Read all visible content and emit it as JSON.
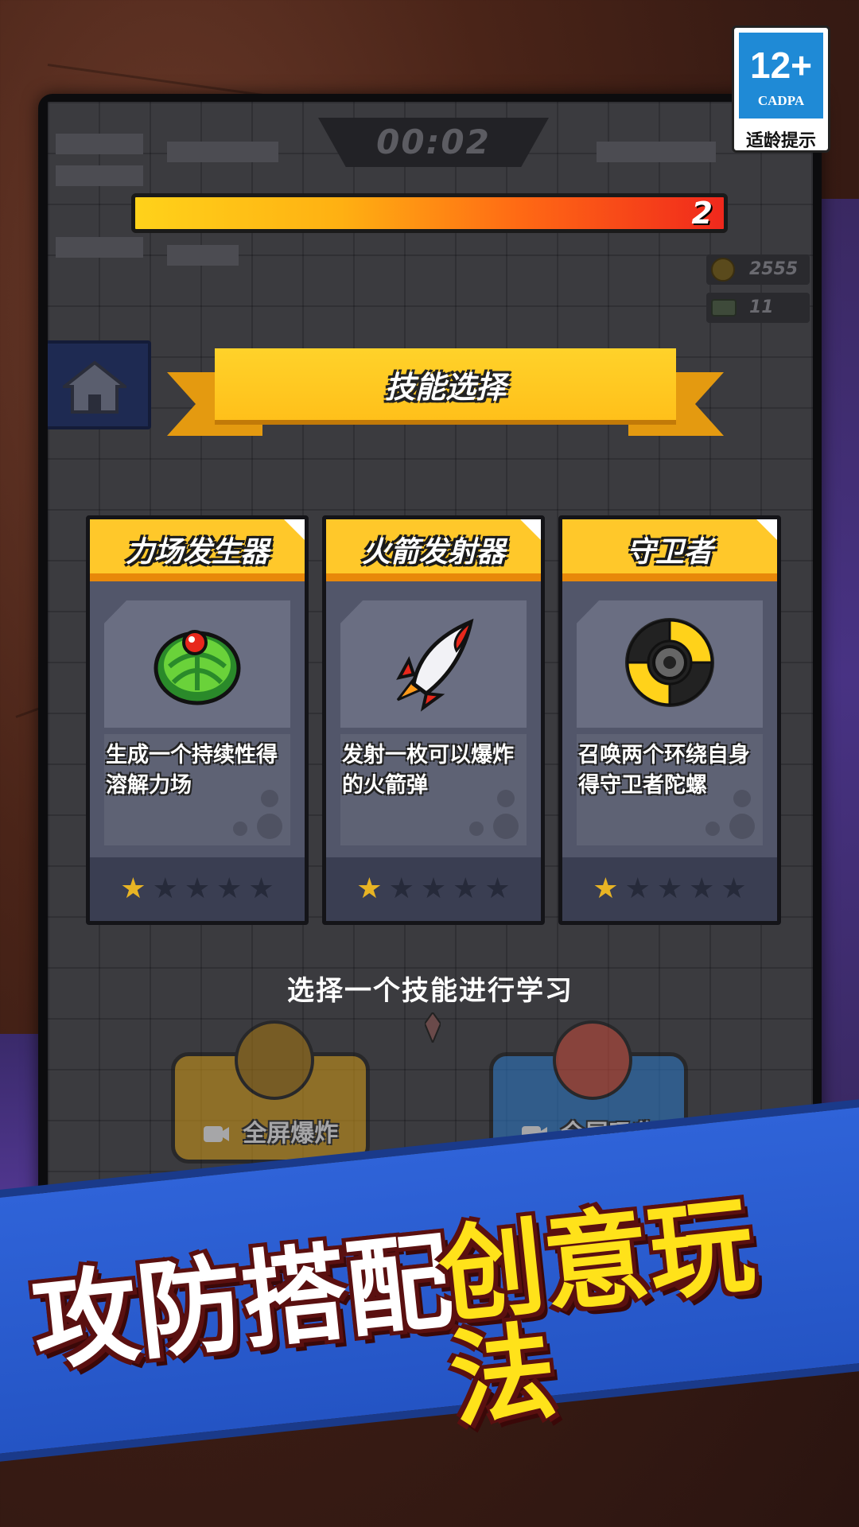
{
  "age_rating": {
    "number": "12+",
    "org": "CADPA",
    "tip": "适龄提示"
  },
  "hud": {
    "timer": "00:02",
    "level": "2",
    "coins": "2555",
    "chips": "11"
  },
  "panel": {
    "title": "技能选择"
  },
  "skills": [
    {
      "name": "力场发生器",
      "description": "生成一个持续性得溶解力场",
      "icon": "force-field-generator-icon",
      "stars_filled": 1,
      "stars_total": 5
    },
    {
      "name": "火箭发射器",
      "description": "发射一枚可以爆炸的火箭弹",
      "icon": "rocket-launcher-icon",
      "stars_filled": 1,
      "stars_total": 5
    },
    {
      "name": "守卫者",
      "description": "召唤两个环绕自身得守卫者陀螺",
      "icon": "guardian-shuriken-icon",
      "stars_filled": 1,
      "stars_total": 5
    }
  ],
  "prompt": "选择一个技能进行学习",
  "actions": {
    "full_screen_explode": "全屏爆炸",
    "full_screen_absorb": "全屏吸收"
  },
  "banner": {
    "left": "攻防搭配",
    "right": "创意玩法"
  },
  "colors": {
    "accent_yellow": "#ffc82a",
    "card_bg": "#52566a",
    "banner_blue": "#2f63d8",
    "star_on": "#e8b424"
  }
}
